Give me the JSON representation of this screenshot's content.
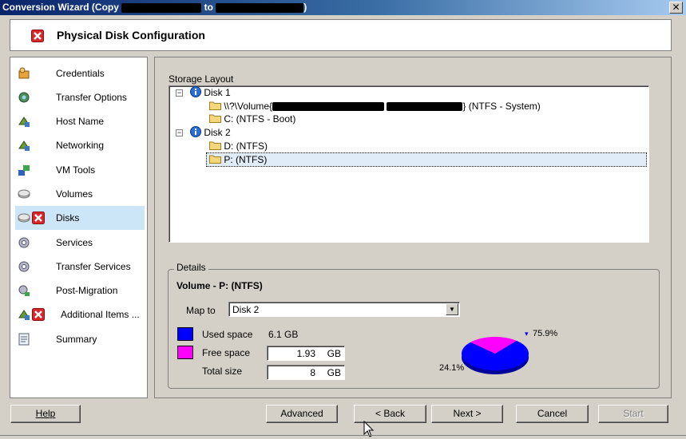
{
  "window": {
    "title_prefix": "Conversion Wizard (Copy",
    "title_middle": "to",
    "title_suffix": ")",
    "close_glyph": "✕"
  },
  "header": {
    "title": "Physical Disk Configuration",
    "icon": "error-x-icon"
  },
  "sidebar": {
    "items": [
      {
        "label": "Credentials",
        "icon": "credentials-icon"
      },
      {
        "label": "Transfer Options",
        "icon": "transfer-options-icon"
      },
      {
        "label": "Host Name",
        "icon": "host-name-icon"
      },
      {
        "label": "Networking",
        "icon": "networking-icon"
      },
      {
        "label": "VM Tools",
        "icon": "vm-tools-icon"
      },
      {
        "label": "Volumes",
        "icon": "volumes-icon"
      },
      {
        "label": "Disks",
        "icon": "disks-icon",
        "error": true,
        "active": true
      },
      {
        "label": "Services",
        "icon": "services-icon"
      },
      {
        "label": "Transfer Services",
        "icon": "transfer-services-icon"
      },
      {
        "label": "Post-Migration",
        "icon": "post-migration-icon"
      },
      {
        "label": "Additional Items ...",
        "icon": "additional-items-icon",
        "error": true
      },
      {
        "label": "Summary",
        "icon": "summary-icon"
      }
    ]
  },
  "storage_layout": {
    "label": "Storage Layout",
    "disks": [
      {
        "name": "Disk 1",
        "volumes": [
          {
            "label_prefix": "\\\\?\\Volume{",
            "label_suffix": "} (NTFS  - System)"
          },
          {
            "label": "C: (NTFS - Boot)"
          }
        ]
      },
      {
        "name": "Disk 2",
        "volumes": [
          {
            "label": "D: (NTFS)"
          },
          {
            "label": "P: (NTFS)",
            "selected": true
          }
        ]
      }
    ]
  },
  "details": {
    "legend": "Details",
    "volume_title": "Volume - P: (NTFS)",
    "map_to_label": "Map to",
    "map_to_value": "Disk 2",
    "used_label": "Used space",
    "used_value": "6.1 GB",
    "free_label": "Free space",
    "free_value": "1.93",
    "free_unit": "GB",
    "total_label": "Total size",
    "total_value": "8",
    "total_unit": "GB",
    "used_color": "#0000ff",
    "free_color": "#ff00ff",
    "pie_used_pct": "75.9%",
    "pie_free_pct": "24.1%",
    "pie_used_fraction": 0.759
  },
  "buttons": {
    "help": "Help",
    "advanced": "Advanced",
    "back": "< Back",
    "next": "Next >",
    "cancel": "Cancel",
    "start": "Start"
  }
}
